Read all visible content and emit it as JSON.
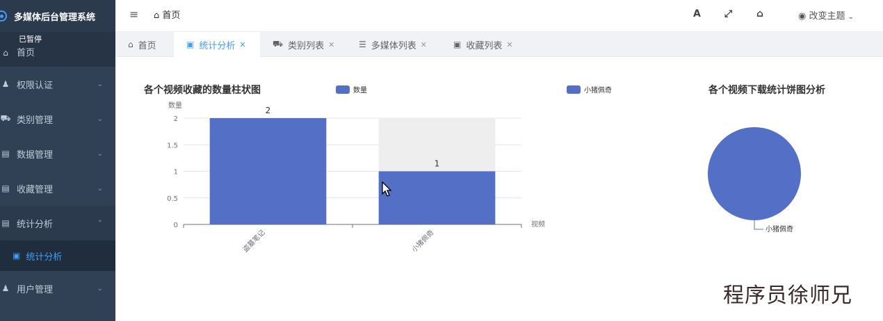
{
  "app": {
    "title": "多媒体后台管理系统",
    "paused_label": "已暂停"
  },
  "sidebar": {
    "items": [
      {
        "label": "首页",
        "icon": "home-icon"
      },
      {
        "label": "权限认证",
        "icon": "user-lock-icon"
      },
      {
        "label": "类别管理",
        "icon": "car-icon"
      },
      {
        "label": "数据管理",
        "icon": "list-icon"
      },
      {
        "label": "收藏管理",
        "icon": "list-icon"
      },
      {
        "label": "统计分析",
        "icon": "list-icon"
      },
      {
        "label": "用户管理",
        "icon": "users-icon"
      }
    ],
    "submenu": {
      "label": "统计分析",
      "icon": "image-icon"
    }
  },
  "header": {
    "breadcrumb": "首页",
    "icons": [
      "font-size-icon",
      "fullscreen-icon",
      "home-icon"
    ],
    "theme_label": "改变主题"
  },
  "tabs": [
    {
      "label": "首页",
      "icon": "home-icon",
      "closable": false,
      "active": false
    },
    {
      "label": "统计分析",
      "icon": "image-icon",
      "closable": true,
      "active": true
    },
    {
      "label": "类别列表",
      "icon": "car-icon",
      "closable": true,
      "active": false
    },
    {
      "label": "多媒体列表",
      "icon": "list-icon",
      "closable": true,
      "active": false
    },
    {
      "label": "收藏列表",
      "icon": "image-icon",
      "closable": true,
      "active": false
    }
  ],
  "colors": {
    "accent": "#409eff",
    "series": "#5470c6",
    "sidebar_bg": "#304156"
  },
  "chart_data": [
    {
      "type": "bar",
      "title": "各个视频收藏的数量柱状图",
      "categories": [
        "盗墓笔记",
        "小猪佩奇"
      ],
      "series": [
        {
          "name": "数量",
          "values": [
            2,
            1
          ]
        }
      ],
      "data_labels": [
        "2",
        "1"
      ],
      "xlabel": "视频",
      "ylabel": "数量",
      "ylim": [
        0,
        2
      ],
      "yticks": [
        "0",
        "0.5",
        "1",
        "1.5",
        "2"
      ],
      "legend": [
        "数量",
        "小猪佩奇"
      ],
      "legend_position": "top",
      "grid": true,
      "highlight_category": "小猪佩奇"
    },
    {
      "type": "pie",
      "title": "各个视频下载统计饼图分析",
      "slices": [
        {
          "name": "小猪佩奇",
          "value": 1
        }
      ]
    }
  ],
  "watermark": "程序员徐师兄"
}
